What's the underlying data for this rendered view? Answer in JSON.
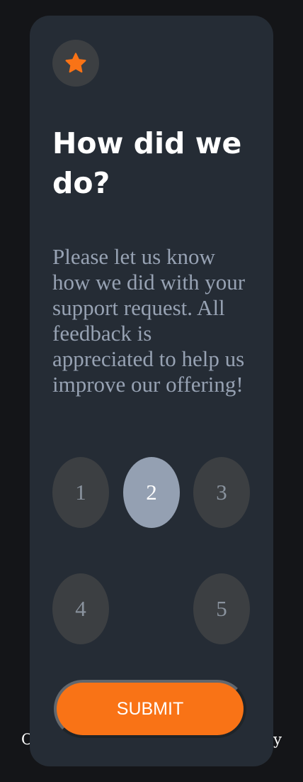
{
  "footer": {
    "left_text": "C",
    "right_text": "y",
    "accent_color": "#f97316"
  },
  "card": {
    "icon": "star-icon",
    "title": "How did we do?",
    "description": "Please let us know how we did with your support request. All feedback is appreciated to help us improve our offering!",
    "ratings": [
      "1",
      "2",
      "3",
      "4",
      "5"
    ],
    "selected_rating": "2",
    "submit_label": "SUBMIT"
  },
  "colors": {
    "page_background": "#141518",
    "card_background": "#252c35",
    "accent": "#f97316",
    "rating_background": "#3c3f42",
    "rating_selected": "#94a0b2",
    "description_text": "#97a2b3"
  }
}
